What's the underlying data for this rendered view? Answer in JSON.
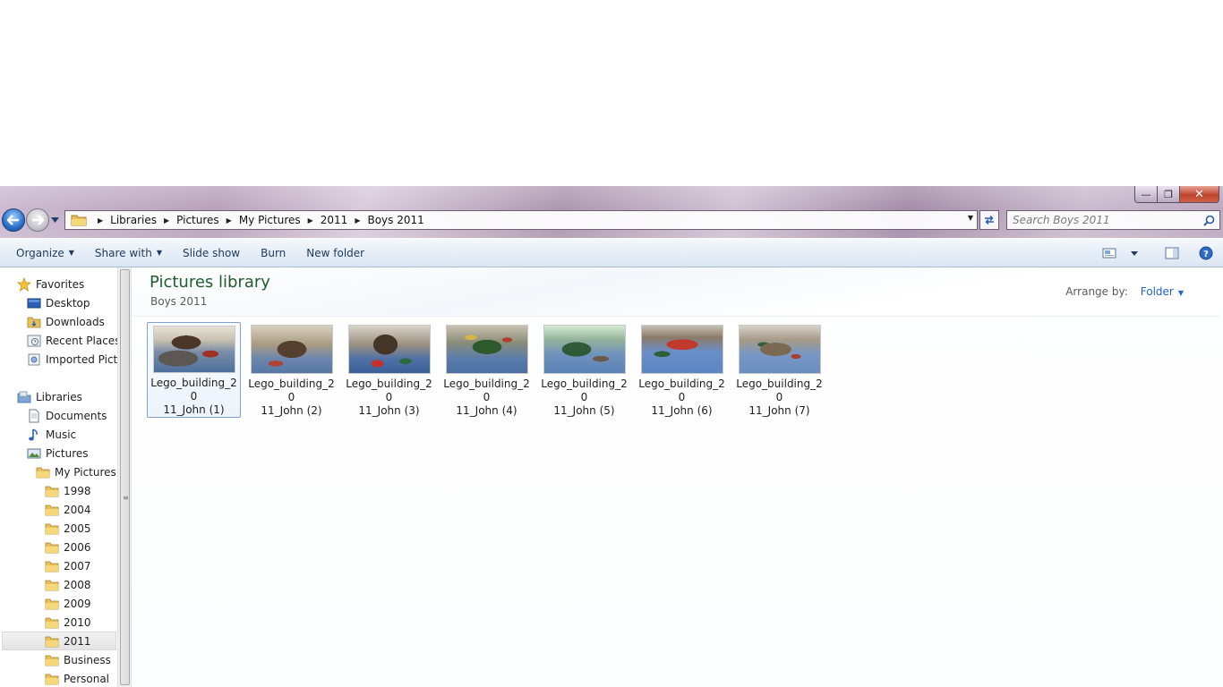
{
  "window": {
    "close_glyph": "✕",
    "min_glyph": "—",
    "max_glyph": "❐"
  },
  "address_bar": {
    "crumbs": [
      "Libraries",
      "Pictures",
      "My Pictures",
      "2011",
      "Boys 2011"
    ]
  },
  "search": {
    "placeholder": "Search Boys 2011"
  },
  "toolbar": {
    "organize": "Organize",
    "share_with": "Share with",
    "slide_show": "Slide show",
    "burn": "Burn",
    "new_folder": "New folder"
  },
  "nav_pane": {
    "favorites": "Favorites",
    "desktop": "Desktop",
    "downloads": "Downloads",
    "recent_places": "Recent Places",
    "imported": "Imported Pictu",
    "libraries": "Libraries",
    "documents": "Documents",
    "music": "Music",
    "pictures": "Pictures",
    "my_pictures": "My Pictures",
    "years": [
      "1998",
      "2004",
      "2005",
      "2006",
      "2007",
      "2008",
      "2009",
      "2010",
      "2011"
    ],
    "business": "Business",
    "personal": "Personal"
  },
  "library": {
    "title": "Pictures library",
    "subtitle": "Boys 2011",
    "arrange_label": "Arrange by:",
    "arrange_value": "Folder"
  },
  "files": [
    {
      "line1": "Lego_building_20",
      "line2": "11_John (1)"
    },
    {
      "line1": "Lego_building_20",
      "line2": "11_John (2)"
    },
    {
      "line1": "Lego_building_20",
      "line2": "11_John (3)"
    },
    {
      "line1": "Lego_building_20",
      "line2": "11_John (4)"
    },
    {
      "line1": "Lego_building_20",
      "line2": "11_John (5)"
    },
    {
      "line1": "Lego_building_20",
      "line2": "11_John (6)"
    },
    {
      "line1": "Lego_building_20",
      "line2": "11_John (7)"
    }
  ],
  "colors": {
    "library_title": "#1e5d2a",
    "link_blue": "#1e66c8",
    "toolbar_text": "#1e395b"
  }
}
